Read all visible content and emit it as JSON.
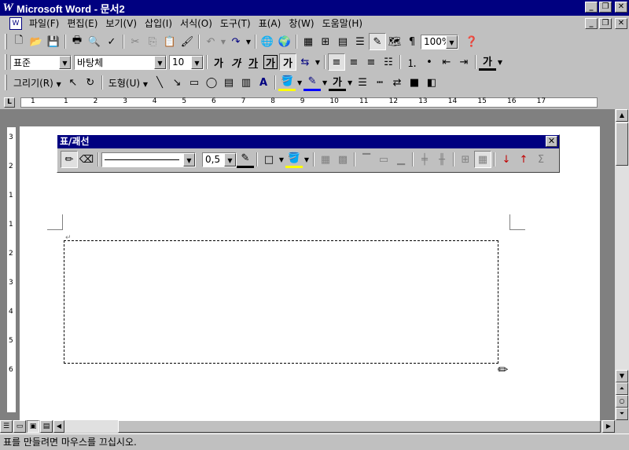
{
  "window": {
    "title": "Microsoft Word - 문서2",
    "icon_letter": "W"
  },
  "menu": [
    "파일(F)",
    "편집(E)",
    "보기(V)",
    "삽입(I)",
    "서식(O)",
    "도구(T)",
    "표(A)",
    "창(W)",
    "도움말(H)"
  ],
  "standard_toolbar": {
    "zoom": "100%"
  },
  "format_toolbar": {
    "style": "표준",
    "font": "바탕체",
    "size": "10",
    "bold": "가",
    "italic": "가",
    "underline": "가",
    "outline": "가",
    "shadow": "가",
    "font_color": "가"
  },
  "drawing_toolbar": {
    "draw_label": "그리기(R)",
    "shapes_label": "도형(U)",
    "font_color": "가"
  },
  "ruler": {
    "corner": "L",
    "labels": [
      "1",
      "1",
      "2",
      "3",
      "4",
      "5",
      "6",
      "7",
      "8",
      "9",
      "10",
      "11",
      "12",
      "13",
      "14",
      "15",
      "16",
      "17"
    ],
    "vlabels": [
      "3",
      "2",
      "1",
      "1",
      "2",
      "3",
      "4",
      "5",
      "6"
    ]
  },
  "table_toolbar": {
    "title": "표/괘선",
    "line_weight": "0,5",
    "sigma": "Σ"
  },
  "status": {
    "text": "표를 만들려면 마우스를 끄십시오."
  },
  "colors": {
    "titlebar": "#000080",
    "face": "#c0c0c0",
    "highlight_yellow": "#ffff00",
    "font_red": "#ff0000"
  }
}
